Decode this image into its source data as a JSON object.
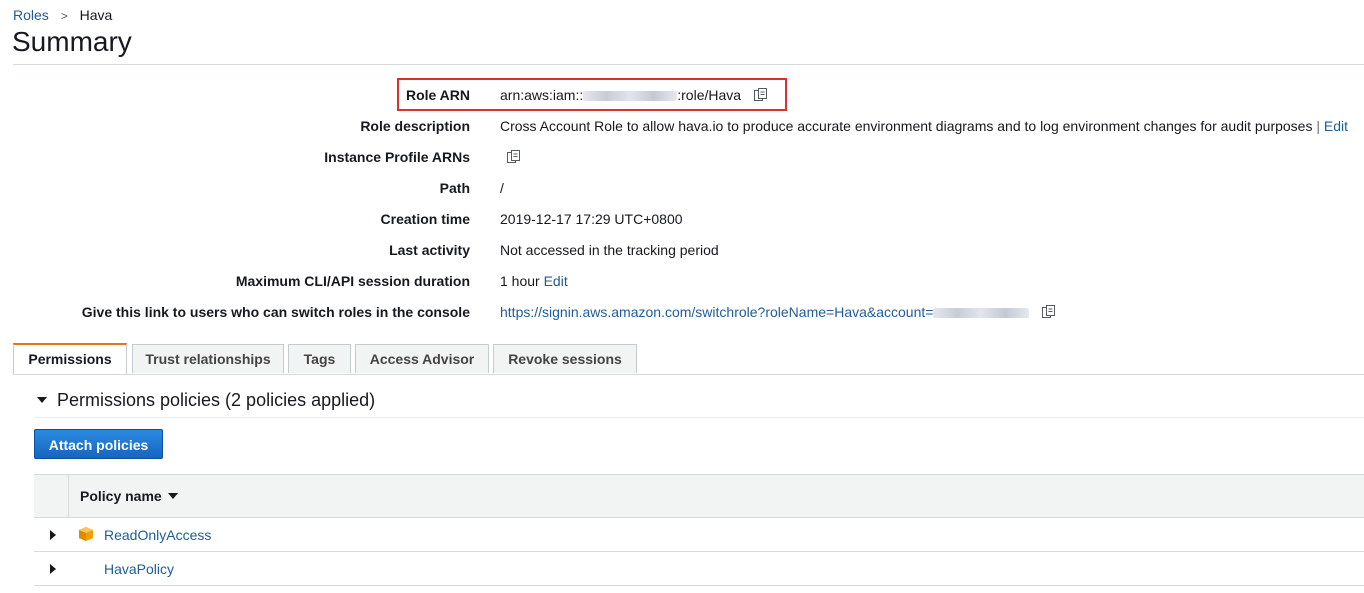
{
  "breadcrumb": {
    "parent": "Roles",
    "current": "Hava"
  },
  "page": {
    "title": "Summary"
  },
  "summary": {
    "role_arn": {
      "label": "Role ARN",
      "prefix": "arn:aws:iam::",
      "suffix": ":role/Hava"
    },
    "role_description": {
      "label": "Role description",
      "value": "Cross Account Role to allow hava.io to produce accurate environment diagrams and to log environment changes for audit purposes",
      "sep": "|",
      "edit": "Edit"
    },
    "instance_profile": {
      "label": "Instance Profile ARNs"
    },
    "path": {
      "label": "Path",
      "value": "/"
    },
    "creation_time": {
      "label": "Creation time",
      "value": "2019-12-17 17:29 UTC+0800"
    },
    "last_activity": {
      "label": "Last activity",
      "value": "Not accessed in the tracking period"
    },
    "max_session": {
      "label": "Maximum CLI/API session duration",
      "value": "1 hour",
      "edit": "Edit"
    },
    "switch_link": {
      "label": "Give this link to users who can switch roles in the console",
      "value": "https://signin.aws.amazon.com/switchrole?roleName=Hava&account="
    }
  },
  "tabs": [
    {
      "label": "Permissions",
      "active": true
    },
    {
      "label": "Trust relationships"
    },
    {
      "label": "Tags"
    },
    {
      "label": "Access Advisor"
    },
    {
      "label": "Revoke sessions"
    }
  ],
  "permissions": {
    "section_title": "Permissions policies (2 policies applied)",
    "attach_button": "Attach policies",
    "column_header": "Policy name",
    "policies": [
      {
        "name": "ReadOnlyAccess",
        "icon": "aws-managed-policy-icon"
      },
      {
        "name": "HavaPolicy"
      }
    ]
  },
  "colors": {
    "link": "#1f5c99",
    "accent_tab": "#ec7211",
    "primary_button": "#1f73c9",
    "highlight": "#d9322a",
    "aws_icon": "#f2a100"
  }
}
